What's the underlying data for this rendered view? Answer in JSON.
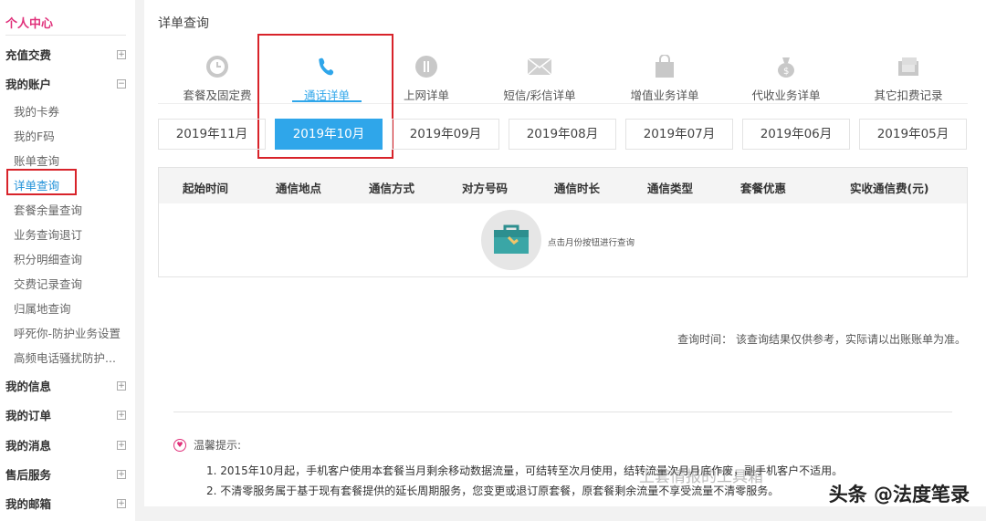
{
  "sidebar": {
    "title": "个人中心",
    "groups": [
      {
        "label": "充值交费",
        "toggle": "+"
      },
      {
        "label": "我的账户",
        "toggle": "−"
      },
      {
        "label": "我的信息",
        "toggle": "+"
      },
      {
        "label": "我的订单",
        "toggle": "+"
      },
      {
        "label": "我的消息",
        "toggle": "+"
      },
      {
        "label": "售后服务",
        "toggle": "+"
      },
      {
        "label": "我的邮箱",
        "toggle": "+"
      }
    ],
    "account_items": [
      "我的卡券",
      "我的F码",
      "账单查询",
      "详单查询",
      "套餐余量查询",
      "业务查询退订",
      "积分明细查询",
      "交费记录查询",
      "归属地查询",
      "呼死你-防护业务设置",
      "高频电话骚扰防护..."
    ],
    "active_item": "详单查询"
  },
  "main": {
    "title": "详单查询",
    "tabs": [
      {
        "label": "套餐及固定费",
        "icon": "clock-icon"
      },
      {
        "label": "通话详单",
        "icon": "phone-icon"
      },
      {
        "label": "上网详单",
        "icon": "data-icon"
      },
      {
        "label": "短信/彩信详单",
        "icon": "mail-icon"
      },
      {
        "label": "增值业务详单",
        "icon": "bag-icon"
      },
      {
        "label": "代收业务详单",
        "icon": "money-bag-icon"
      },
      {
        "label": "其它扣费记录",
        "icon": "receipt-icon"
      }
    ],
    "active_tab": "通话详单",
    "months": [
      "2019年11月",
      "2019年10月",
      "2019年09月",
      "2019年08月",
      "2019年07月",
      "2019年06月",
      "2019年05月"
    ],
    "active_month": "2019年10月",
    "table_headers": [
      "起始时间",
      "通信地点",
      "通信方式",
      "对方号码",
      "通信时长",
      "通信类型",
      "套餐优惠",
      "实收通信费(元)"
    ],
    "empty_hint": "点击月份按钮进行查询",
    "query_time": "查询时间：  该查询结果仅供参考，实际请以出账账单为准。",
    "tips_title": "温馨提示:",
    "tips": [
      "1. 2015年10月起，手机客户使用本套餐当月剩余移动数据流量，可结转至次月使用，结转流量次月月底作废，副手机客户不适用。",
      "2. 不清零服务属于基于现有套餐提供的延长周期服务，您变更或退订原套餐，原套餐剩余流量不享受流量不清零服务。"
    ]
  },
  "watermark": {
    "text": "头条 @法度笔录",
    "text2": "上套情报的工具箱"
  },
  "colors": {
    "accent": "#2fa6ea",
    "brand": "#e0307a",
    "highlight": "#d8232a"
  }
}
